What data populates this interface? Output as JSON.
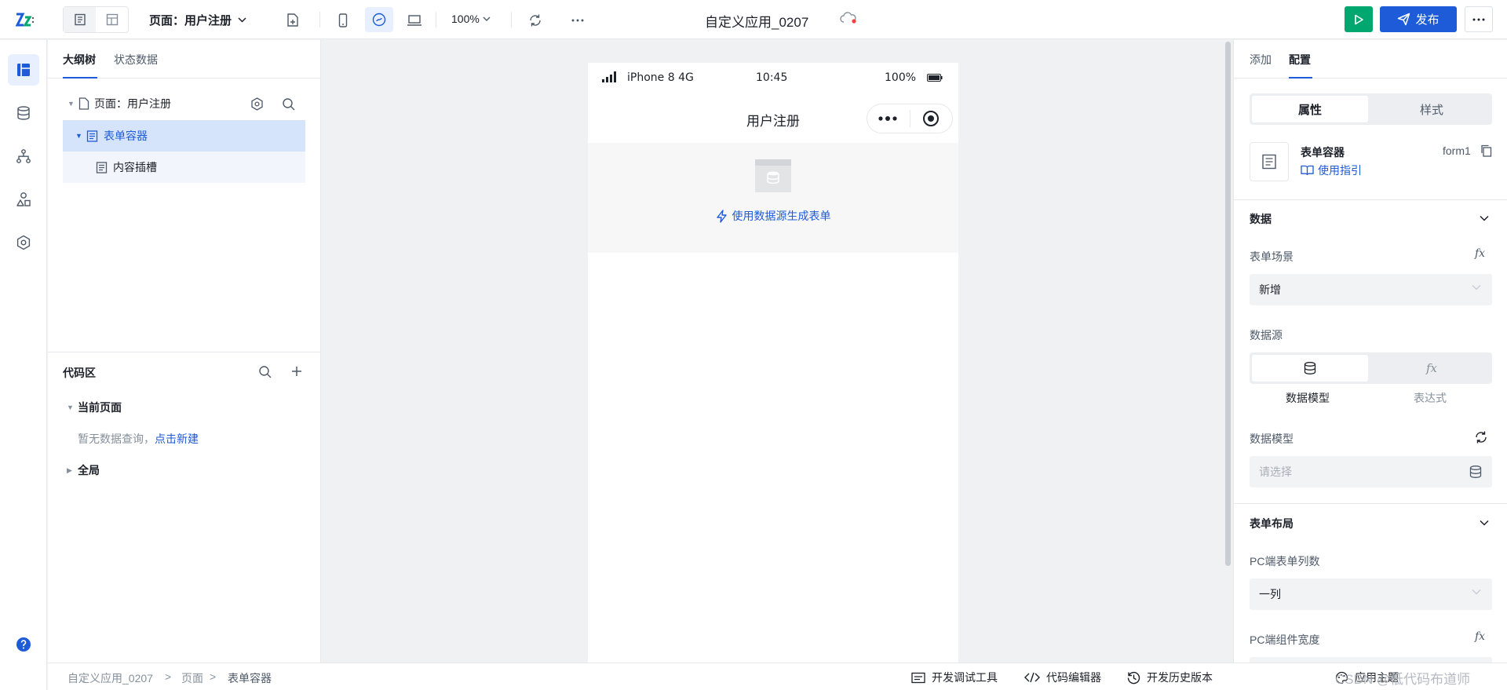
{
  "topbar": {
    "page_label": "页面：用户注册",
    "zoom": "100%",
    "app_title": "自定义应用_0207",
    "publish_label": "发布"
  },
  "outline": {
    "tabs": [
      "大纲树",
      "状态数据"
    ],
    "items": [
      {
        "label": "页面：用户注册"
      },
      {
        "label": "表单容器"
      },
      {
        "label": "内容插槽"
      }
    ]
  },
  "code": {
    "title": "代码区",
    "current_page": "当前页面",
    "empty_text": "暂无数据查询，",
    "create_link": "点击新建",
    "global": "全局"
  },
  "phone": {
    "carrier": "iPhone 8  4G",
    "time": "10:45",
    "battery": "100%",
    "nav_title": "用户注册",
    "generate_link": "使用数据源生成表单"
  },
  "config": {
    "tabs": [
      "添加",
      "配置"
    ],
    "segments": [
      "属性",
      "样式"
    ],
    "component_name": "表单容器",
    "component_id": "form1",
    "guide_link": "使用指引",
    "data_section": "数据",
    "form_scene_label": "表单场景",
    "form_scene_value": "新增",
    "datasource_label": "数据源",
    "datasource_options": [
      "数据模型",
      "表达式"
    ],
    "data_model_label": "数据模型",
    "data_model_placeholder": "请选择",
    "layout_section": "表单布局",
    "pc_columns_label": "PC端表单列数",
    "pc_columns_value": "一列",
    "pc_width_label": "PC端组件宽度",
    "fx": "fx"
  },
  "footer": {
    "breadcrumb": [
      "自定义应用_0207",
      "页面",
      "表单容器"
    ],
    "tools": [
      "开发调试工具",
      "代码编辑器",
      "开发历史版本"
    ],
    "theme": "应用主题",
    "watermark": "CSDN @低代码布道师"
  },
  "colors": {
    "primary": "#1e5bd8",
    "run": "#00a870",
    "selected_row": "#d6e4fb"
  }
}
